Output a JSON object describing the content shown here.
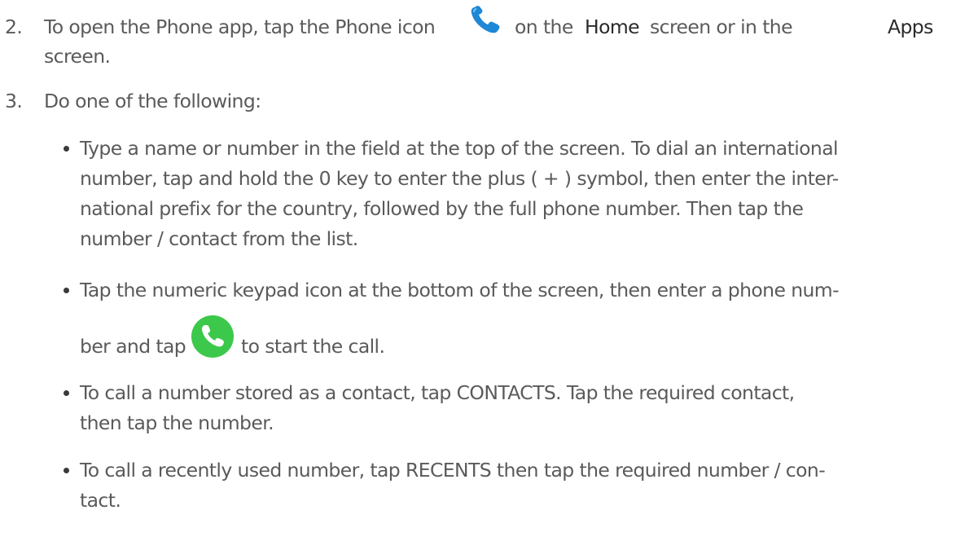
{
  "step2": {
    "number": "2.",
    "line1_a": "To open the Phone app, tap the Phone icon",
    "line1_b": "on the",
    "home_label": "Home",
    "line1_c": "screen or in the",
    "apps_label": "Apps",
    "line2": "screen.",
    "phone_icon": "phone-handset-icon",
    "phone_icon_color": "#1e88d6"
  },
  "step3": {
    "number": "3.",
    "intro": "Do one of the following:",
    "bullets": [
      {
        "lines": [
          "Type a name or number in the field at the top of the screen. To dial an international",
          "number, tap and hold the 0 key to enter the plus ( + ) symbol, then enter the inter-",
          "national prefix for the country, followed by the full phone number. Then tap the",
          "number / contact from the list."
        ]
      },
      {
        "lines": [
          "Tap the numeric keypad icon at the bottom of the screen, then enter a phone num-"
        ],
        "line_b_a": "ber and tap",
        "line_b_b": "to start the call.",
        "call_icon": "call-button-icon",
        "call_icon_color": "#3cc84a"
      },
      {
        "lines": [
          "To call a number stored as a contact, tap CONTACTS. Tap the required contact,",
          "then tap the number."
        ]
      },
      {
        "lines": [
          "To call a recently used number, tap RECENTS then tap the required number / con-",
          "tact."
        ]
      }
    ]
  }
}
